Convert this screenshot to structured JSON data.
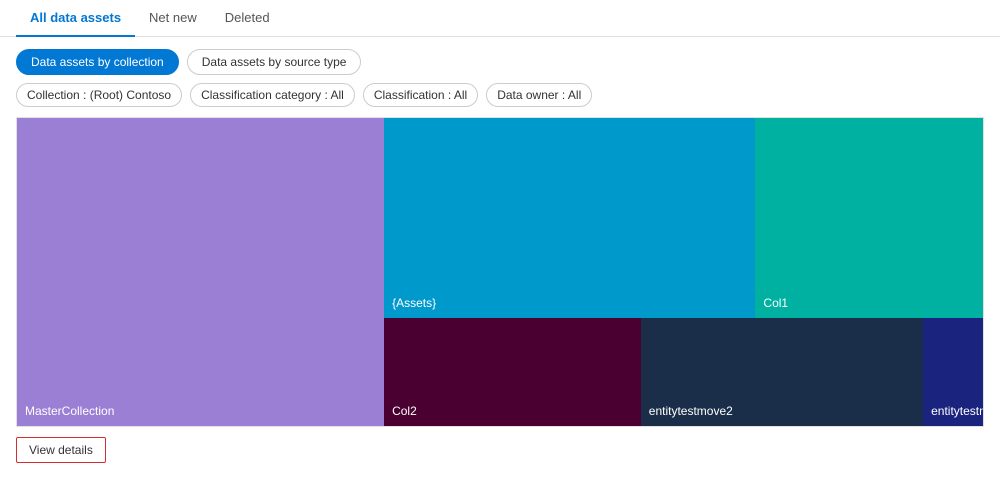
{
  "tabs": {
    "items": [
      {
        "label": "All data assets",
        "active": true
      },
      {
        "label": "Net new",
        "active": false
      },
      {
        "label": "Deleted",
        "active": false
      }
    ]
  },
  "toggles": {
    "items": [
      {
        "label": "Data assets by collection",
        "active": true
      },
      {
        "label": "Data assets by source type",
        "active": false
      }
    ]
  },
  "filters": {
    "items": [
      {
        "label": "Collection : (Root) Contoso"
      },
      {
        "label": "Classification category : All"
      },
      {
        "label": "Classification : All"
      },
      {
        "label": "Data owner : All"
      }
    ]
  },
  "treemap": {
    "blocks": {
      "master": {
        "label": "MasterCollection"
      },
      "assets": {
        "label": "{Assets}"
      },
      "col1": {
        "label": "Col1"
      },
      "col2": {
        "label": "Col2"
      },
      "entity2": {
        "label": "entitytestmove2"
      },
      "entitymov": {
        "label": "entitytestmov..."
      }
    }
  },
  "actions": {
    "view_details": "View details"
  }
}
